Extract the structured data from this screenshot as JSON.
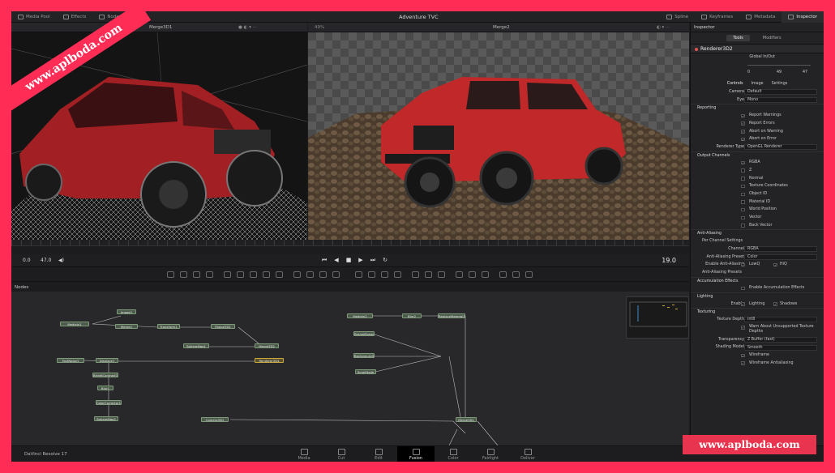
{
  "topbar": {
    "left_items": [
      "Media Pool",
      "Effects",
      "Nodes"
    ],
    "title": "Adventure TVC",
    "right_items": [
      "Spline",
      "Keyframes",
      "Metadata",
      "Inspector"
    ]
  },
  "viewers": {
    "left": {
      "title": "Merge3D1"
    },
    "right": {
      "title": "Merge2",
      "zoom": "49%"
    }
  },
  "transport": {
    "start": "0.0",
    "current": "47.0",
    "end": "19.0"
  },
  "nodes_panel": {
    "title": "Nodes",
    "nodes": [
      "Image1",
      "MediaIn1",
      "Merge1",
      "Transform1",
      "Shape3D1",
      "SphereMap1",
      "Merge3D2",
      "FastNoise1",
      "Displace1",
      "Renderer3D4",
      "BrightContrast1",
      "Blur1",
      "ColorCorrector1",
      "SphereMap2",
      "Camera3D1",
      "MediaIn2",
      "Blur2",
      "ReplaceMaterial1",
      "ResizeMosaic",
      "Background1",
      "Merge3D1",
      "SmallNode"
    ]
  },
  "inspector": {
    "title": "Inspector",
    "tabs": [
      "Tools",
      "Modifiers"
    ],
    "tool_name": "Renderer3D2",
    "global_label": "Global In/Out",
    "global_values": [
      "0",
      "49",
      "47"
    ],
    "subtabs": [
      "Controls",
      "Image",
      "Settings"
    ],
    "camera": {
      "label": "Camera",
      "value": "Default"
    },
    "eye": {
      "label": "Eye",
      "value": "Mono"
    },
    "reporting": {
      "label": "Reporting",
      "items": [
        "Report Warnings",
        "Report Errors",
        "Abort on Warning",
        "Abort on Error"
      ]
    },
    "renderer_type": {
      "label": "Renderer Type",
      "value": "OpenGL Renderer"
    },
    "output_channels": {
      "label": "Output Channels",
      "items": [
        "RGBA",
        "Z",
        "Normal",
        "Texture Coordinates",
        "Object ID",
        "Material ID",
        "World Position",
        "Vector",
        "Back Vector"
      ]
    },
    "anti_aliasing": {
      "label": "Anti-Aliasing",
      "per_channel": "Per Channel Settings",
      "channel": {
        "label": "Channel",
        "value": "RGBA"
      },
      "preset": {
        "label": "Anti-Aliasing Preset",
        "value": "Color"
      },
      "enable_label": "Enable Anti-Aliasing",
      "lowq": "LowQ",
      "hiq": "HiQ",
      "presets": "Anti-Aliasing Presets"
    },
    "accumulation": {
      "label": "Accumulation Effects",
      "enable": "Enable Accumulation Effects"
    },
    "lighting": {
      "label": "Lighting",
      "enable": "Enable",
      "lighting": "Lighting",
      "shadows": "Shadows"
    },
    "texturing": {
      "label": "Texturing",
      "depth_label": "Texture Depth",
      "depth_value": "int8",
      "warn": "Warn About Unsupported Texture Depths"
    },
    "transparency": {
      "label": "Transparency",
      "value": "Z Buffer (fast)"
    },
    "shading": {
      "label": "Shading Model",
      "value": "Smooth"
    },
    "wireframe": "Wireframe",
    "wireframe_aa": "Wireframe Antialiasing"
  },
  "bottombar": {
    "brand": "DaVinci Resolve 17",
    "pages": [
      "Media",
      "Cut",
      "Edit",
      "Fusion",
      "Color",
      "Fairlight",
      "Deliver"
    ],
    "active_page": "Fusion"
  },
  "watermark": {
    "ribbon": "www.aplboda.com",
    "box": "www.aplboda.com"
  },
  "colors": {
    "frame": "#ff2d55",
    "app_bg": "#1c1c1e",
    "node_green": "#4b5a4a",
    "jeep_red": "#c0282a"
  }
}
